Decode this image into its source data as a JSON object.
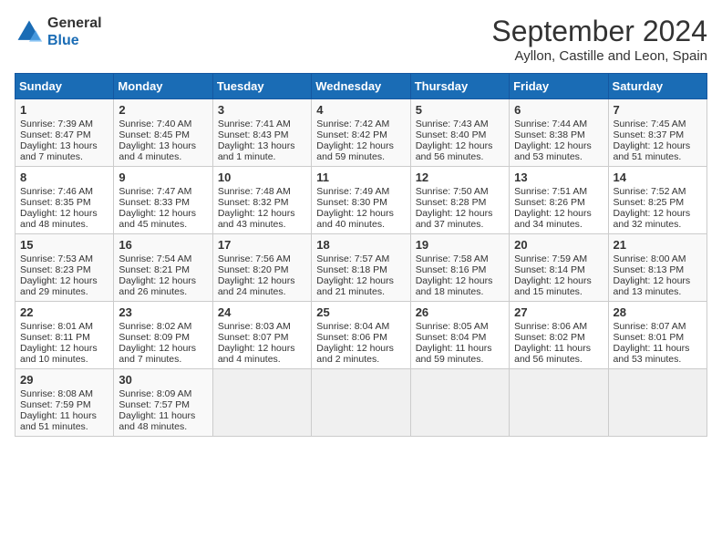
{
  "header": {
    "logo_line1": "General",
    "logo_line2": "Blue",
    "main_title": "September 2024",
    "subtitle": "Ayllon, Castille and Leon, Spain"
  },
  "weekdays": [
    "Sunday",
    "Monday",
    "Tuesday",
    "Wednesday",
    "Thursday",
    "Friday",
    "Saturday"
  ],
  "weeks": [
    [
      {
        "day": "1",
        "lines": [
          "Sunrise: 7:39 AM",
          "Sunset: 8:47 PM",
          "Daylight: 13 hours",
          "and 7 minutes."
        ]
      },
      {
        "day": "2",
        "lines": [
          "Sunrise: 7:40 AM",
          "Sunset: 8:45 PM",
          "Daylight: 13 hours",
          "and 4 minutes."
        ]
      },
      {
        "day": "3",
        "lines": [
          "Sunrise: 7:41 AM",
          "Sunset: 8:43 PM",
          "Daylight: 13 hours",
          "and 1 minute."
        ]
      },
      {
        "day": "4",
        "lines": [
          "Sunrise: 7:42 AM",
          "Sunset: 8:42 PM",
          "Daylight: 12 hours",
          "and 59 minutes."
        ]
      },
      {
        "day": "5",
        "lines": [
          "Sunrise: 7:43 AM",
          "Sunset: 8:40 PM",
          "Daylight: 12 hours",
          "and 56 minutes."
        ]
      },
      {
        "day": "6",
        "lines": [
          "Sunrise: 7:44 AM",
          "Sunset: 8:38 PM",
          "Daylight: 12 hours",
          "and 53 minutes."
        ]
      },
      {
        "day": "7",
        "lines": [
          "Sunrise: 7:45 AM",
          "Sunset: 8:37 PM",
          "Daylight: 12 hours",
          "and 51 minutes."
        ]
      }
    ],
    [
      {
        "day": "8",
        "lines": [
          "Sunrise: 7:46 AM",
          "Sunset: 8:35 PM",
          "Daylight: 12 hours",
          "and 48 minutes."
        ]
      },
      {
        "day": "9",
        "lines": [
          "Sunrise: 7:47 AM",
          "Sunset: 8:33 PM",
          "Daylight: 12 hours",
          "and 45 minutes."
        ]
      },
      {
        "day": "10",
        "lines": [
          "Sunrise: 7:48 AM",
          "Sunset: 8:32 PM",
          "Daylight: 12 hours",
          "and 43 minutes."
        ]
      },
      {
        "day": "11",
        "lines": [
          "Sunrise: 7:49 AM",
          "Sunset: 8:30 PM",
          "Daylight: 12 hours",
          "and 40 minutes."
        ]
      },
      {
        "day": "12",
        "lines": [
          "Sunrise: 7:50 AM",
          "Sunset: 8:28 PM",
          "Daylight: 12 hours",
          "and 37 minutes."
        ]
      },
      {
        "day": "13",
        "lines": [
          "Sunrise: 7:51 AM",
          "Sunset: 8:26 PM",
          "Daylight: 12 hours",
          "and 34 minutes."
        ]
      },
      {
        "day": "14",
        "lines": [
          "Sunrise: 7:52 AM",
          "Sunset: 8:25 PM",
          "Daylight: 12 hours",
          "and 32 minutes."
        ]
      }
    ],
    [
      {
        "day": "15",
        "lines": [
          "Sunrise: 7:53 AM",
          "Sunset: 8:23 PM",
          "Daylight: 12 hours",
          "and 29 minutes."
        ]
      },
      {
        "day": "16",
        "lines": [
          "Sunrise: 7:54 AM",
          "Sunset: 8:21 PM",
          "Daylight: 12 hours",
          "and 26 minutes."
        ]
      },
      {
        "day": "17",
        "lines": [
          "Sunrise: 7:56 AM",
          "Sunset: 8:20 PM",
          "Daylight: 12 hours",
          "and 24 minutes."
        ]
      },
      {
        "day": "18",
        "lines": [
          "Sunrise: 7:57 AM",
          "Sunset: 8:18 PM",
          "Daylight: 12 hours",
          "and 21 minutes."
        ]
      },
      {
        "day": "19",
        "lines": [
          "Sunrise: 7:58 AM",
          "Sunset: 8:16 PM",
          "Daylight: 12 hours",
          "and 18 minutes."
        ]
      },
      {
        "day": "20",
        "lines": [
          "Sunrise: 7:59 AM",
          "Sunset: 8:14 PM",
          "Daylight: 12 hours",
          "and 15 minutes."
        ]
      },
      {
        "day": "21",
        "lines": [
          "Sunrise: 8:00 AM",
          "Sunset: 8:13 PM",
          "Daylight: 12 hours",
          "and 13 minutes."
        ]
      }
    ],
    [
      {
        "day": "22",
        "lines": [
          "Sunrise: 8:01 AM",
          "Sunset: 8:11 PM",
          "Daylight: 12 hours",
          "and 10 minutes."
        ]
      },
      {
        "day": "23",
        "lines": [
          "Sunrise: 8:02 AM",
          "Sunset: 8:09 PM",
          "Daylight: 12 hours",
          "and 7 minutes."
        ]
      },
      {
        "day": "24",
        "lines": [
          "Sunrise: 8:03 AM",
          "Sunset: 8:07 PM",
          "Daylight: 12 hours",
          "and 4 minutes."
        ]
      },
      {
        "day": "25",
        "lines": [
          "Sunrise: 8:04 AM",
          "Sunset: 8:06 PM",
          "Daylight: 12 hours",
          "and 2 minutes."
        ]
      },
      {
        "day": "26",
        "lines": [
          "Sunrise: 8:05 AM",
          "Sunset: 8:04 PM",
          "Daylight: 11 hours",
          "and 59 minutes."
        ]
      },
      {
        "day": "27",
        "lines": [
          "Sunrise: 8:06 AM",
          "Sunset: 8:02 PM",
          "Daylight: 11 hours",
          "and 56 minutes."
        ]
      },
      {
        "day": "28",
        "lines": [
          "Sunrise: 8:07 AM",
          "Sunset: 8:01 PM",
          "Daylight: 11 hours",
          "and 53 minutes."
        ]
      }
    ],
    [
      {
        "day": "29",
        "lines": [
          "Sunrise: 8:08 AM",
          "Sunset: 7:59 PM",
          "Daylight: 11 hours",
          "and 51 minutes."
        ]
      },
      {
        "day": "30",
        "lines": [
          "Sunrise: 8:09 AM",
          "Sunset: 7:57 PM",
          "Daylight: 11 hours",
          "and 48 minutes."
        ]
      },
      null,
      null,
      null,
      null,
      null
    ]
  ]
}
